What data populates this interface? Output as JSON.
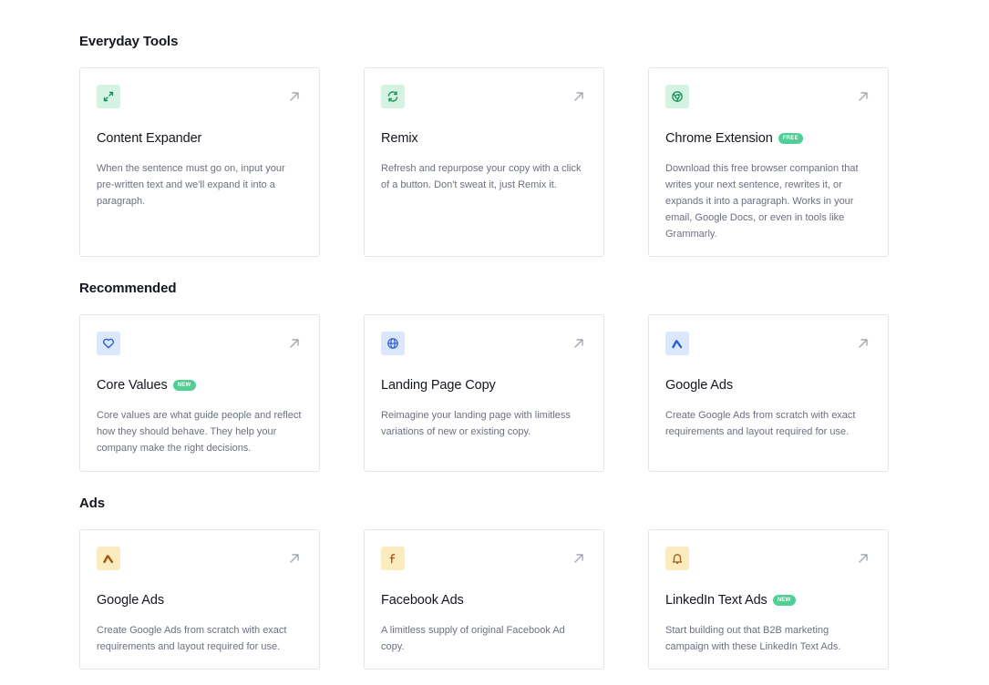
{
  "sections": [
    {
      "title": "Everyday Tools",
      "cards": [
        {
          "icon": "expand-icon",
          "accent": "#d4f3e3",
          "title": "Content Expander",
          "badge": "",
          "description": "When the sentence must go on, input your pre-written text and we'll expand it into a paragraph."
        },
        {
          "icon": "refresh-icon",
          "accent": "#d4f3e3",
          "title": "Remix",
          "badge": "",
          "description": "Refresh and repurpose your copy with a click of a button. Don't sweat it, just Remix it."
        },
        {
          "icon": "chrome-icon",
          "accent": "#d4f3e3",
          "title": "Chrome Extension",
          "badge": "FREE",
          "description": "Download this free browser companion that writes your next sentence, rewrites it, or expands it into a paragraph. Works in your email, Google Docs, or even in tools like Grammarly."
        }
      ]
    },
    {
      "title": "Recommended",
      "cards": [
        {
          "icon": "heart-icon",
          "accent": "#dbe7fb",
          "title": "Core Values",
          "badge": "NEW",
          "description": "Core values are what guide people and reflect how they should behave. They help your company make the right decisions."
        },
        {
          "icon": "globe-icon",
          "accent": "#dbe7fb",
          "title": "Landing Page Copy",
          "badge": "",
          "description": "Reimagine your landing page with limitless variations of new or existing copy."
        },
        {
          "icon": "google-ads-icon",
          "accent": "#dbe7fb",
          "title": "Google Ads",
          "badge": "",
          "description": "Create Google Ads from scratch with exact requirements and layout required for use."
        }
      ]
    },
    {
      "title": "Ads",
      "cards": [
        {
          "icon": "google-ads-icon",
          "accent": "#fbecc0",
          "title": "Google Ads",
          "badge": "",
          "description": "Create Google Ads from scratch with exact requirements and layout required for use."
        },
        {
          "icon": "facebook-icon",
          "accent": "#fbecc0",
          "title": "Facebook Ads",
          "badge": "",
          "description": "A limitless supply of original Facebook Ad copy."
        },
        {
          "icon": "bell-icon",
          "accent": "#fbecc0",
          "title": "LinkedIn Text Ads",
          "badge": "NEW",
          "description": "Start building out that B2B marketing campaign with these LinkedIn Text Ads."
        }
      ]
    }
  ]
}
